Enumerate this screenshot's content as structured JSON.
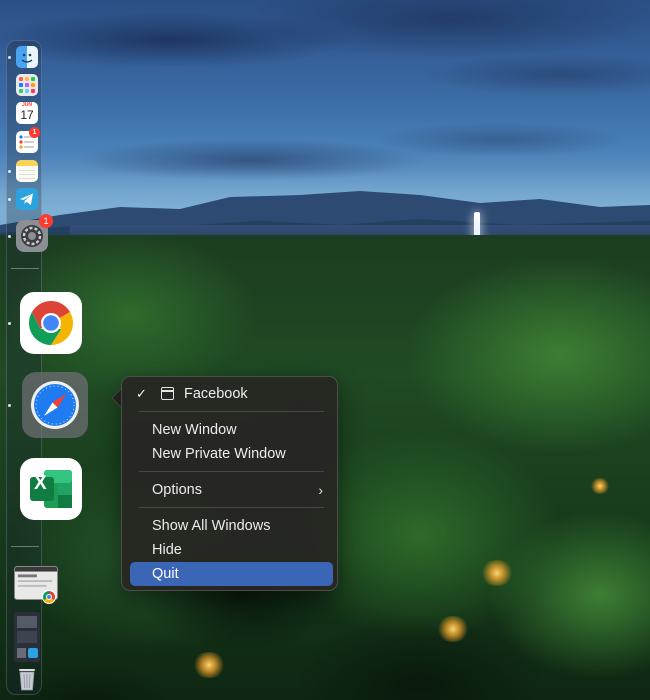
{
  "dock": {
    "apps": [
      {
        "name": "Finder",
        "icon": "finder-icon"
      },
      {
        "name": "Launchpad",
        "icon": "launchpad-icon"
      },
      {
        "name": "Calendar",
        "icon": "calendar-icon",
        "month": "JUN",
        "day": "17"
      },
      {
        "name": "Reminders",
        "icon": "reminders-icon",
        "badge": "1"
      },
      {
        "name": "Notes",
        "icon": "notes-icon"
      },
      {
        "name": "Telegram",
        "icon": "telegram-icon"
      },
      {
        "name": "System Settings",
        "icon": "settings-icon",
        "badge": "1"
      },
      {
        "name": "Google Chrome",
        "icon": "chrome-icon"
      },
      {
        "name": "Safari",
        "icon": "safari-icon"
      },
      {
        "name": "Microsoft Excel",
        "icon": "excel-icon",
        "letter": "X"
      },
      {
        "name": "Chrome window",
        "icon": "window-thumbnail-icon"
      },
      {
        "name": "Downloads",
        "icon": "downloads-stack-icon"
      },
      {
        "name": "Trash",
        "icon": "trash-icon"
      }
    ]
  },
  "context_menu": {
    "window_item": "Facebook",
    "items": {
      "new_window": "New Window",
      "new_private_window": "New Private Window",
      "options": "Options",
      "show_all_windows": "Show All Windows",
      "hide": "Hide",
      "quit": "Quit"
    },
    "highlighted": "Quit"
  },
  "colors": {
    "menu_highlight": "#3a66b5",
    "badge": "#ff3b30"
  }
}
